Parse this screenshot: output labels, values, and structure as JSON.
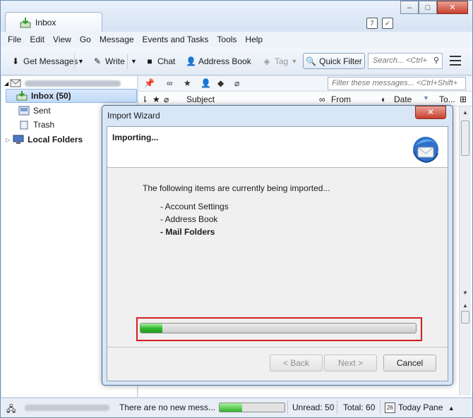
{
  "window": {
    "tab_title": "Inbox",
    "minimize": "–",
    "maximize": "□",
    "close": "✕"
  },
  "menubar": [
    "File",
    "Edit",
    "View",
    "Go",
    "Message",
    "Events and Tasks",
    "Tools",
    "Help"
  ],
  "toolbar": {
    "get_messages": "Get Messages",
    "write": "Write",
    "chat": "Chat",
    "address_book": "Address Book",
    "tag": "Tag",
    "quick_filter": "Quick Filter",
    "search_placeholder": "Search... <Ctrl+"
  },
  "folders": {
    "inbox": "Inbox (50)",
    "sent": "Sent",
    "trash": "Trash",
    "local": "Local Folders"
  },
  "message_list": {
    "filter_placeholder": "Filter these messages... <Ctrl+Shift+",
    "columns": {
      "subject": "Subject",
      "from": "From",
      "date": "Date",
      "to": "To..."
    }
  },
  "dialog": {
    "title": "Import Wizard",
    "close": "✕",
    "heading": "Importing...",
    "intro": "The following items are currently being imported...",
    "items": [
      "- Account Settings",
      "- Address Book",
      "- Mail Folders"
    ],
    "progress": 0.08,
    "buttons": {
      "back": "< Back",
      "next": "Next >",
      "cancel": "Cancel"
    }
  },
  "statusbar": {
    "message": "There are no new mess...",
    "progress": 0.35,
    "unread": "Unread: 50",
    "total": "Total: 60",
    "today_pane": "Today Pane",
    "calendar_day": "26"
  },
  "colors": {
    "accent": "#2fb52a",
    "highlight_border": "#d61f1f",
    "close_button": "#c7402e"
  }
}
